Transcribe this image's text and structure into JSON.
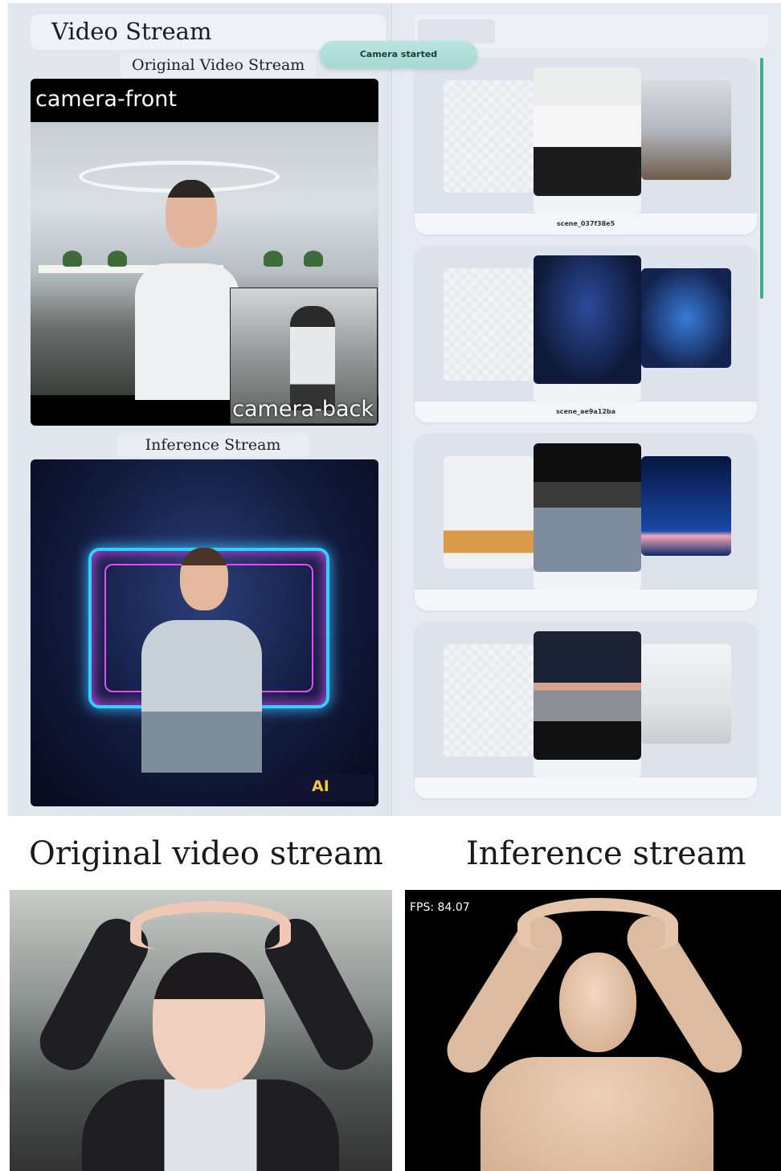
{
  "app": {
    "title": "Video Stream",
    "toast": "Camera started",
    "original_section_label": "Original Video Stream",
    "inference_section_label": "Inference Stream",
    "camera_front_label": "camera-front",
    "camera_back_label": "camera-back",
    "watermark": "AI"
  },
  "scenes": [
    {
      "id": "scene_037f38e5",
      "center_bg": "#e9eaec",
      "right_bg": "#8f9aa6"
    },
    {
      "id": "scene_ae9a12ba",
      "center_bg": "#0f1a3a",
      "right_bg": "#132350"
    },
    {
      "id": "",
      "center_bg": "#262626",
      "right_bg": "#0d2a6b"
    },
    {
      "id": "",
      "center_bg": "#1a2233",
      "right_bg": "#eceeef"
    }
  ],
  "comparison": {
    "original_heading": "Original video stream",
    "inference_heading": "Inference stream",
    "fps_text": "FPS: 84.07"
  },
  "colors": {
    "toast_bg": "#a6d9d4",
    "scroll_accent": "#3fae8a",
    "holo_cyan": "#2fd1ff",
    "holo_magenta": "#e24bff"
  }
}
